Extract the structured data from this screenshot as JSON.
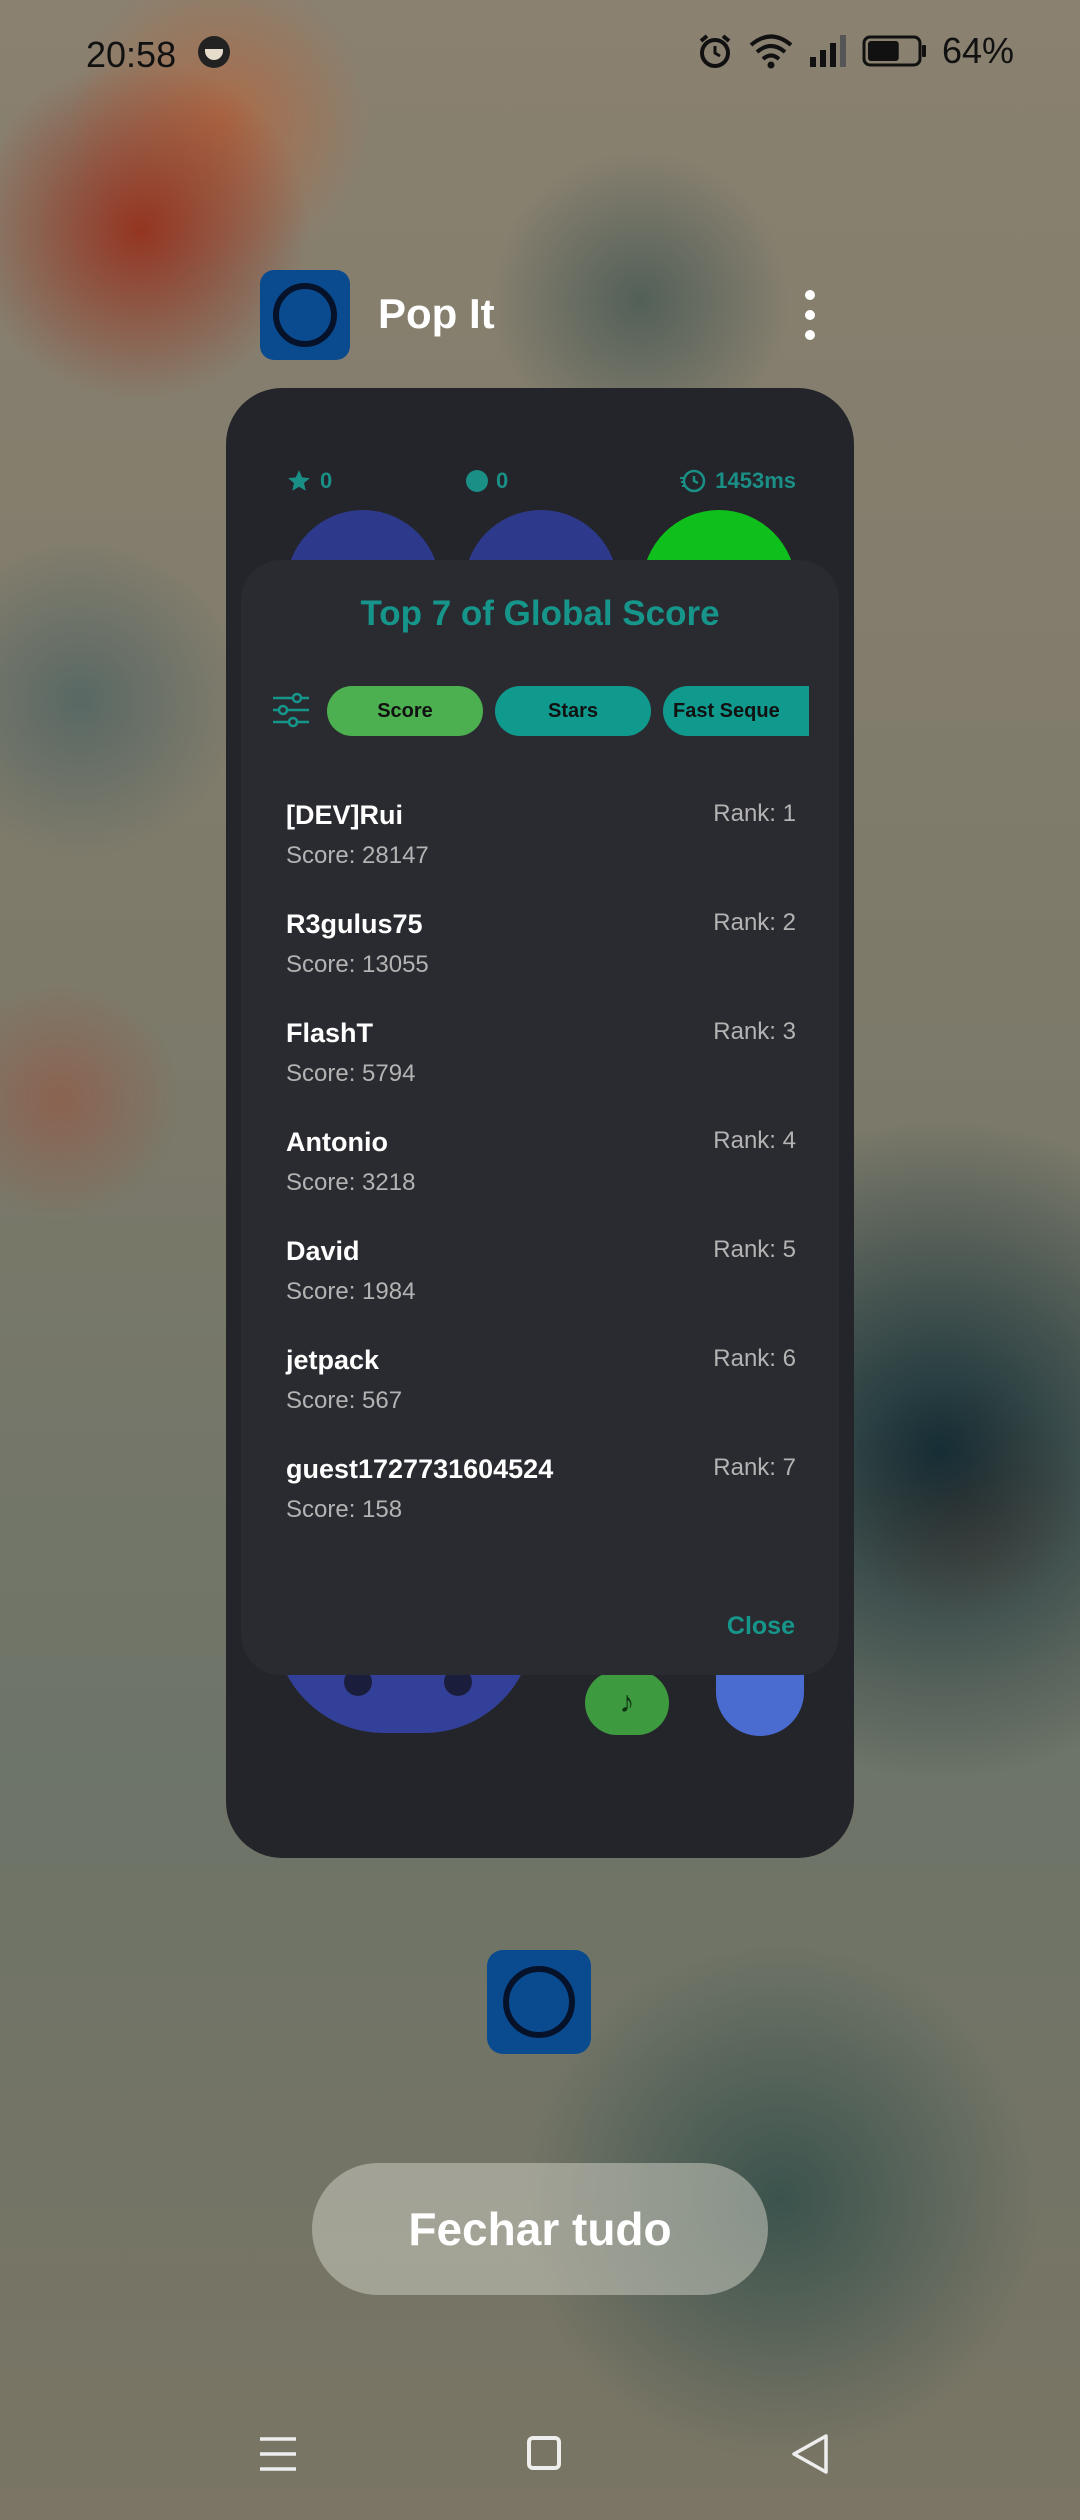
{
  "status_bar": {
    "time": "20:58",
    "battery_percent": "64%",
    "battery_level": 0.64,
    "icons": [
      "face-icon",
      "alarm-icon",
      "wifi-icon",
      "signal-icon",
      "battery-icon"
    ]
  },
  "app_header": {
    "title": "Pop It",
    "icon": "pop-it-app-icon",
    "menu_icon": "more-vert-icon"
  },
  "game": {
    "stars": "0",
    "pops": "0",
    "time": "1453ms",
    "music_icon": "♪"
  },
  "dialog": {
    "title": "Top 7 of Global Score",
    "filter_icon": "filter-sliders-icon",
    "chips": [
      "Score",
      "Stars",
      "Fast Seque"
    ],
    "selected_chip": "Score",
    "entries": [
      {
        "name": "[DEV]Rui",
        "score": "Score: 28147",
        "rank": "Rank: 1"
      },
      {
        "name": "R3gulus75",
        "score": "Score: 13055",
        "rank": "Rank: 2"
      },
      {
        "name": "FlashT",
        "score": "Score: 5794",
        "rank": "Rank: 3"
      },
      {
        "name": "Antonio",
        "score": "Score: 3218",
        "rank": "Rank: 4"
      },
      {
        "name": "David",
        "score": "Score: 1984",
        "rank": "Rank: 5"
      },
      {
        "name": "jetpack",
        "score": "Score: 567",
        "rank": "Rank: 6"
      },
      {
        "name": "guest1727731604524",
        "score": "Score: 158",
        "rank": "Rank: 7"
      }
    ],
    "close_label": "Close"
  },
  "recents": {
    "close_all_label": "Fechar tudo"
  },
  "colors": {
    "accent": "#16968b",
    "chip_selected": "#4caf50",
    "dialog_bg": "#2a2b30",
    "app_icon_bg": "#0a4a8e"
  },
  "nav": {
    "icons": [
      "recents-menu-icon",
      "home-icon",
      "back-icon"
    ]
  }
}
